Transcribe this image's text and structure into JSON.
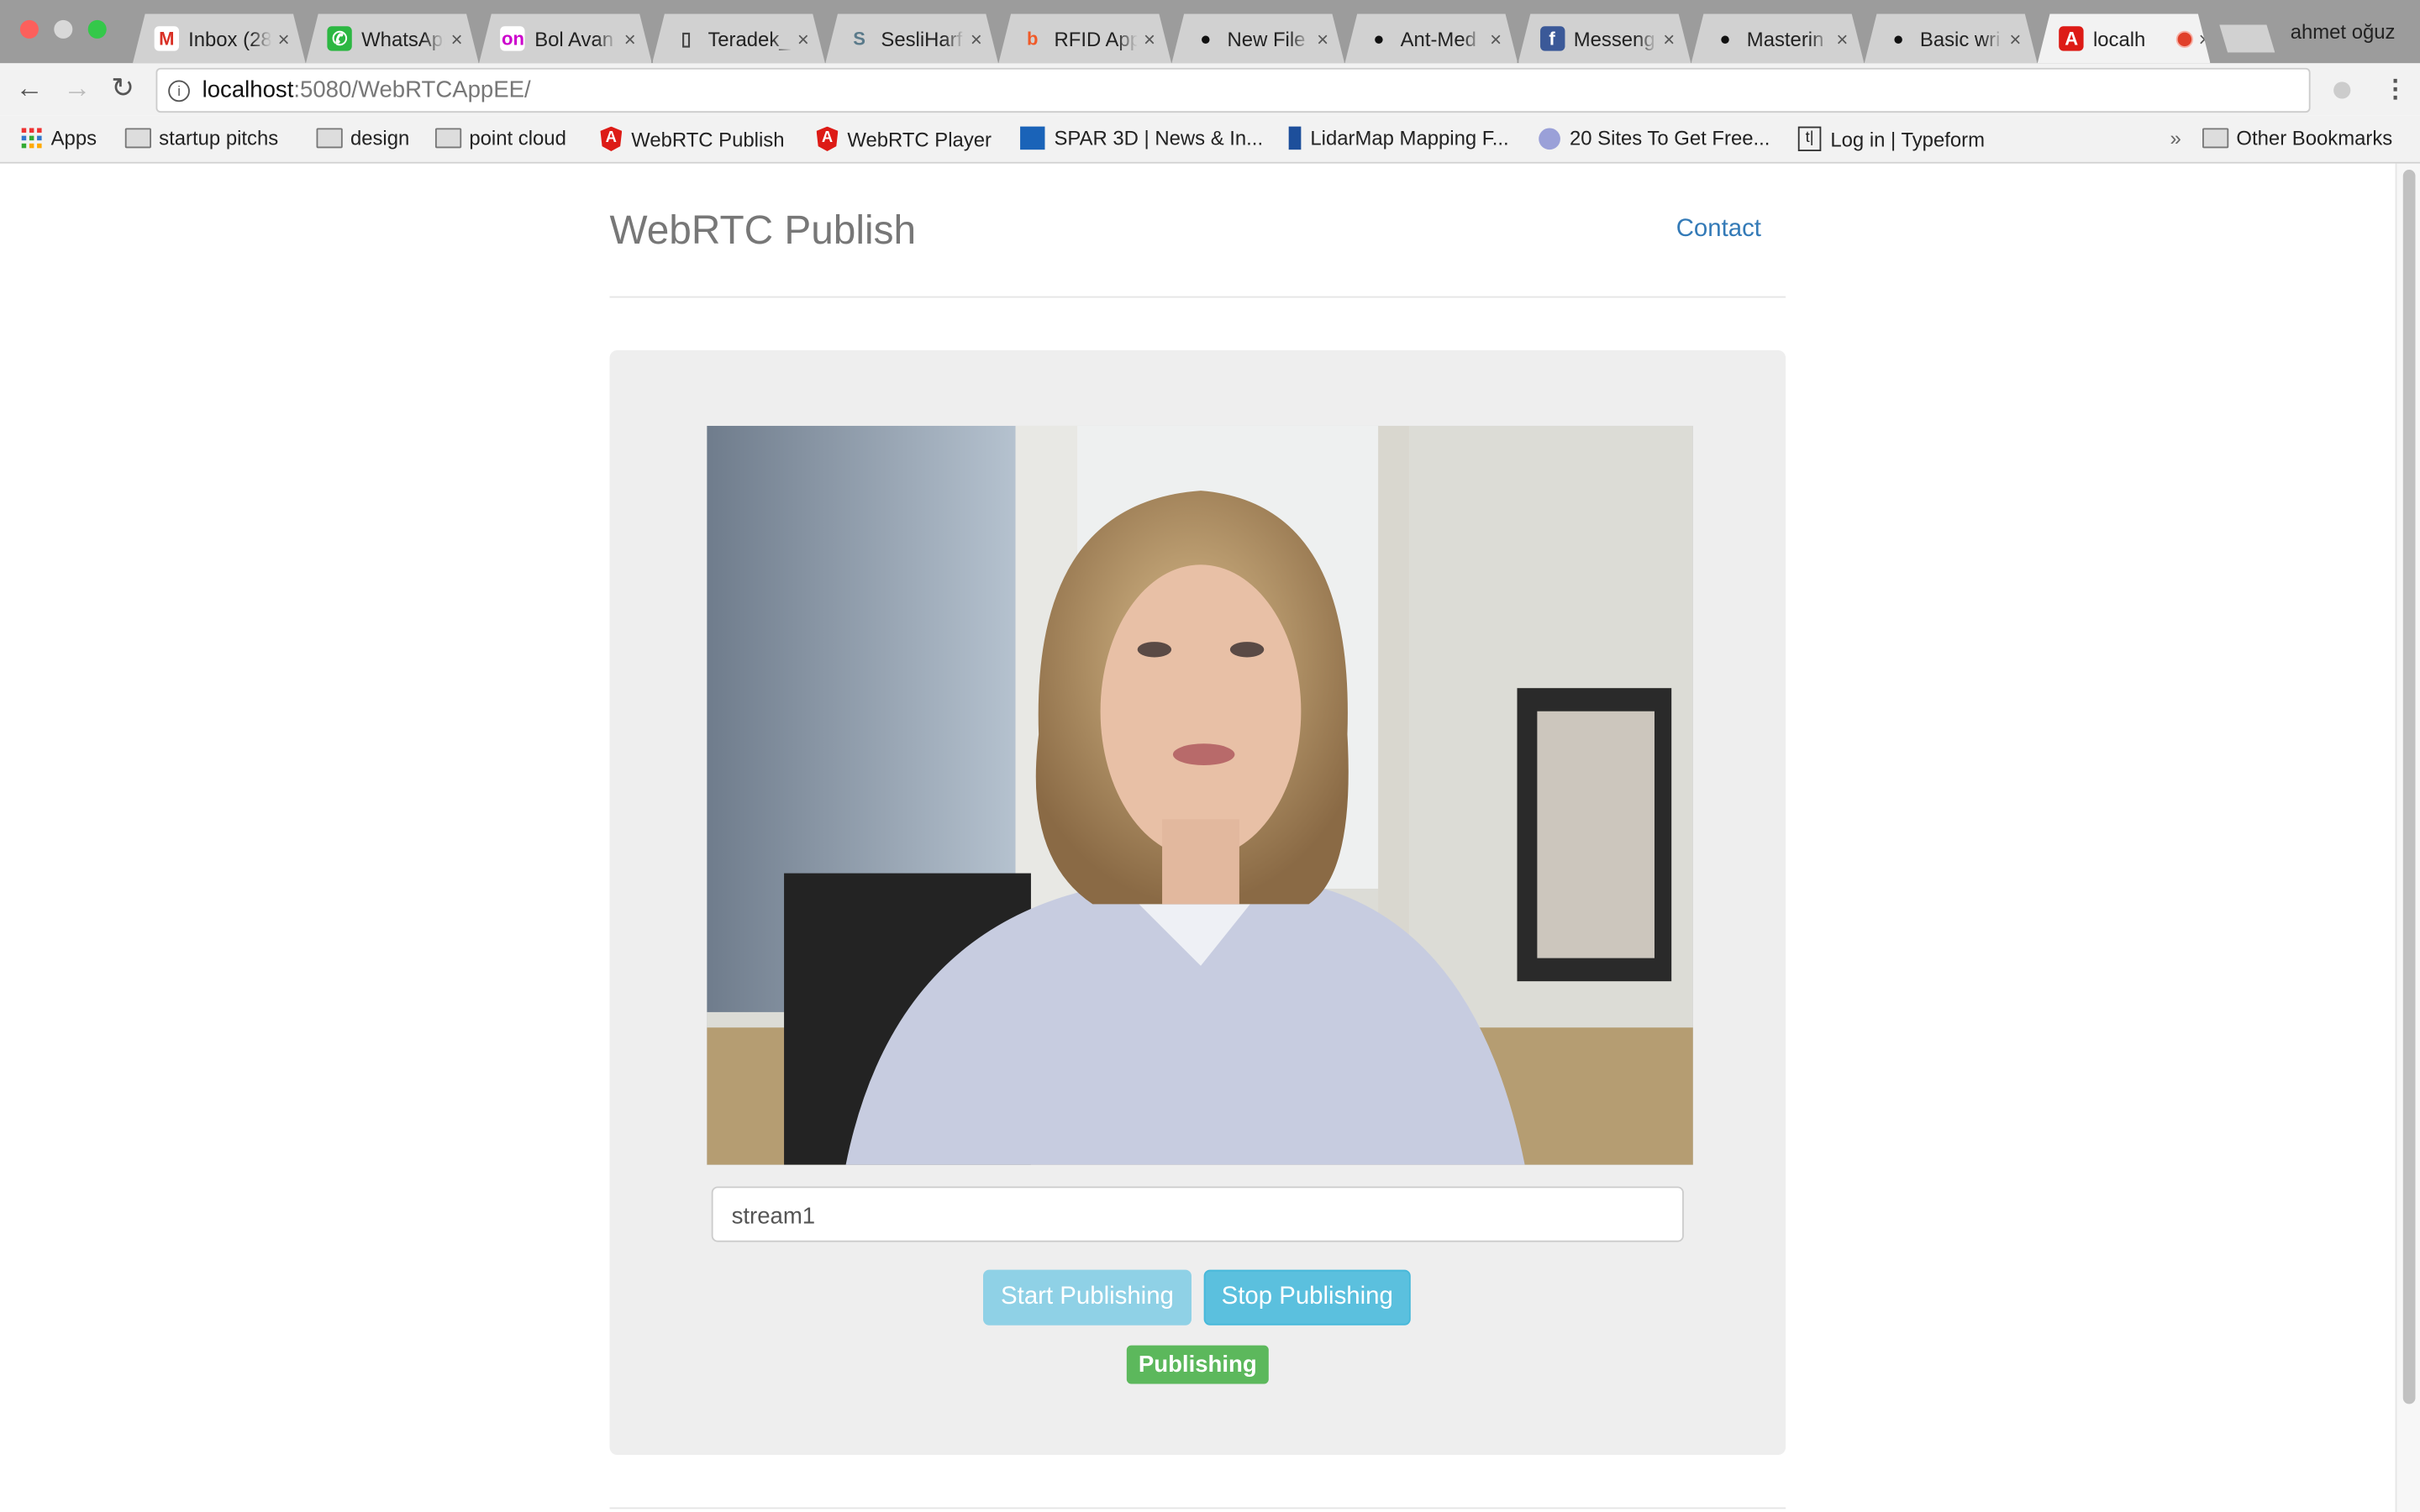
{
  "browser": {
    "tabs": [
      {
        "title": "Inbox (28",
        "icon": "gmail-icon"
      },
      {
        "title": "WhatsApp",
        "icon": "whatsapp-icon"
      },
      {
        "title": "Bol Avan",
        "icon": "on-icon"
      },
      {
        "title": "Teradek_",
        "icon": "document-icon"
      },
      {
        "title": "SesliHarf",
        "icon": "s-icon"
      },
      {
        "title": "RFID App",
        "icon": "b-icon"
      },
      {
        "title": "New File",
        "icon": "github-icon"
      },
      {
        "title": "Ant-Med",
        "icon": "github-icon"
      },
      {
        "title": "Messeng",
        "icon": "facebook-icon"
      },
      {
        "title": "Masterin",
        "icon": "github-icon"
      },
      {
        "title": "Basic wri",
        "icon": "github-icon"
      },
      {
        "title": "localh",
        "icon": "angular-icon",
        "active": true,
        "recording": true
      }
    ],
    "profile": "ahmet oğuz",
    "url_host": "localhost",
    "url_path": ":5080/WebRTCAppEE/",
    "bookmarks": [
      {
        "label": "Apps",
        "icon": "apps-icon"
      },
      {
        "label": "startup pitchs",
        "icon": "folder-icon"
      },
      {
        "label": "design",
        "icon": "folder-icon"
      },
      {
        "label": "point cloud",
        "icon": "folder-icon"
      },
      {
        "label": "WebRTC Publish",
        "icon": "angular-icon"
      },
      {
        "label": "WebRTC Player",
        "icon": "angular-icon"
      },
      {
        "label": "SPAR 3D | News & In...",
        "icon": "spar-icon"
      },
      {
        "label": "LidarMap Mapping F...",
        "icon": "lidarmap-icon"
      },
      {
        "label": "20 Sites To Get Free...",
        "icon": "globe-icon"
      },
      {
        "label": "Log in | Typeform",
        "icon": "typeform-icon"
      }
    ],
    "more": "»",
    "other_bookmarks": "Other Bookmarks"
  },
  "page": {
    "title": "WebRTC Publish",
    "contact": "Contact",
    "stream_input_value": "stream1",
    "start_button": "Start Publishing",
    "stop_button": "Stop Publishing",
    "status_badge": "Publishing",
    "colors": {
      "info": "#5bc0de",
      "info_disabled": "#8fd1e6",
      "success": "#5cb85c",
      "link": "#337ab7"
    }
  }
}
